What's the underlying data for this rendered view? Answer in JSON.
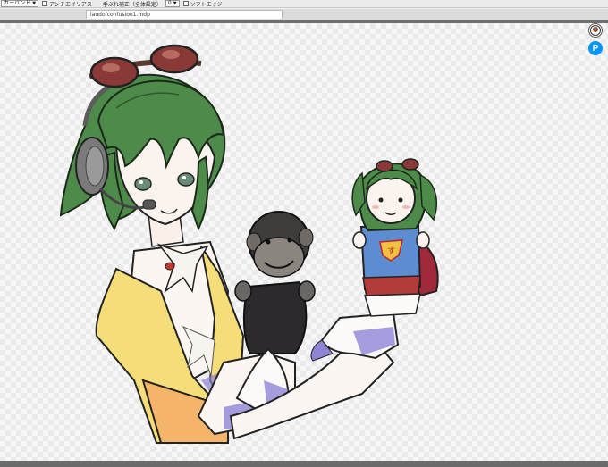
{
  "toolbar": {
    "brush_select": "カーバンド",
    "antialias_label": "アンチエイリアス",
    "correction_label": "手ぶれ補正（全体設定）",
    "correction_value": "0",
    "soft_edge_label": "ソフトエッジ"
  },
  "document": {
    "tab_title": "landofconfusion1.mdp"
  },
  "side_buttons": {
    "pixiv_label": "P"
  },
  "colors": {
    "hair": "#4e8a4a",
    "goggles": "#8a3a36",
    "vest": "#f5de7a",
    "puppet_blue": "#5d8cd0",
    "puppet_skirt": "#b23b3b",
    "shading": "#7b6fc6",
    "pixiv_blue": "#0096fa"
  }
}
